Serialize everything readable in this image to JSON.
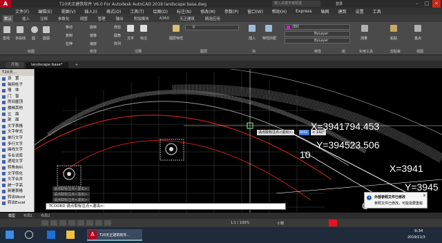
{
  "titlebar": {
    "title": "T20天正建筑软件 V6.0 For Autodesk AutoCAD 2018    landscape base.dwg",
    "search_placeholder": "键入关键字或短语",
    "user": "登录"
  },
  "menubar": [
    "文件(F)",
    "编辑(E)",
    "视图(V)",
    "插入(I)",
    "格式(O)",
    "工具(T)",
    "绘图(D)",
    "标注(N)",
    "修改(M)",
    "参数(P)",
    "窗口(W)",
    "帮助(H)",
    "Express",
    "轴网",
    "建筑",
    "设置",
    "工具"
  ],
  "ribbon_tabs": [
    "默认",
    "插入",
    "注释",
    "参数化",
    "视图",
    "管理",
    "输出",
    "附加模块",
    "A360",
    "天正建筑",
    "精选应用"
  ],
  "ribbon_active": "默认",
  "ribbon": {
    "draw_items": [
      "直线",
      "多段线",
      "圆",
      "圆弧"
    ],
    "modify_items": [
      "移动",
      "旋转",
      "修剪",
      "复制",
      "镜像",
      "圆角",
      "拉伸",
      "缩放",
      "阵列"
    ],
    "annotation_items": [
      "文字",
      "标注"
    ],
    "layer_label": "图层特性",
    "layer_value": "0",
    "block_label": "插入",
    "match_label": "特性匹配",
    "color_value": "洋红",
    "linetype_value": "ByLayer",
    "lineweight_value": "ByLayer",
    "groups": {
      "draw": "绘图",
      "modify": "修改",
      "annotation": "注释",
      "layers": "图层",
      "block": "块",
      "properties": "特性",
      "groups": "组",
      "utilities": "实用工具",
      "clipboard": "剪贴板",
      "view": "视图"
    },
    "utility_label": "测量",
    "paste_label": "粘贴",
    "base_label": "基点"
  },
  "doc_tabs": [
    "开始",
    "landscape base*"
  ],
  "t20_panel": {
    "header": "T20天...",
    "items": [
      "设　置",
      "轴网柱子",
      "墙　体",
      "门　窗",
      "房间屋顶",
      "楼梯其他",
      "立　面",
      "剖　面",
      "文字表格",
      "文字样式",
      "单行文字",
      "多行文字",
      "曲线文字",
      "专业词库",
      "递增文字",
      "转角自纠",
      "文字转化",
      "文字合并",
      "统一字高",
      "新建表格",
      "转出Word",
      "转出Excel"
    ]
  },
  "drawing": {
    "coord1_x": "X=3941794.453",
    "coord1_y": "Y=394523.506",
    "coord2_x": "X=3941",
    "coord2_y": "Y=3945",
    "text_10": "10",
    "label_c": "C",
    "tooltip": "请点取标注点<退出>:",
    "tooltip_input": "2002",
    "tooltip_angle": "< 142°"
  },
  "command_history": [
    "请点取标注点<退出>:",
    "请点取标注点<退出>:",
    "请点取标注点<退出>:"
  ],
  "command_line": "TCOORD 请点取标注点<退出>:",
  "model_tabs": [
    "模型",
    "布局1",
    "布局2"
  ],
  "status": {
    "scale": "1:1 / 100%",
    "units": "小数"
  },
  "notification": {
    "title": "外部参照文件已修改",
    "body": "参照文件已修改，可能需要重载"
  },
  "taskbar": {
    "time": "9:34",
    "date": "2019/11/3",
    "app_label": "T20天正建筑软件..."
  }
}
